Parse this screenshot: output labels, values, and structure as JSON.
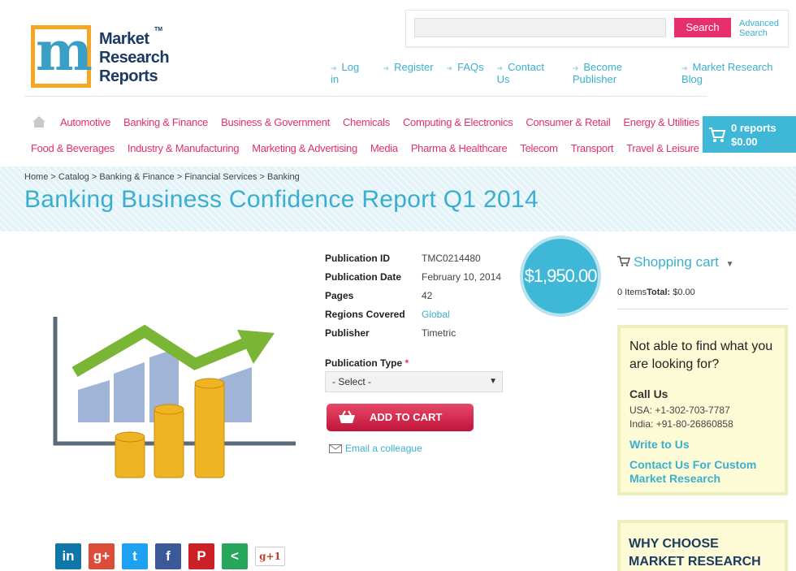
{
  "logo": {
    "line1": "Market",
    "line2": "Research",
    "line3": "Reports",
    "tm": "TM",
    "letter": "m"
  },
  "search": {
    "button": "Search",
    "advanced_line1": "Advanced",
    "advanced_line2": "Search",
    "placeholder": ""
  },
  "top_links": [
    "Log in",
    "Register",
    "FAQs",
    "Contact Us",
    "Become Publisher",
    "Market Research Blog"
  ],
  "categories_row1": [
    "Automotive",
    "Banking & Finance",
    "Business & Government",
    "Chemicals",
    "Computing & Electronics",
    "Consumer & Retail",
    "Energy & Utilities"
  ],
  "categories_row2": [
    "Food & Beverages",
    "Industry & Manufacturing",
    "Marketing & Advertising",
    "Media",
    "Pharma & Healthcare",
    "Telecom",
    "Transport",
    "Travel & Leisure"
  ],
  "cart": {
    "count": "0 reports",
    "total": "$0.00"
  },
  "breadcrumb": "Home > Catalog > Banking & Finance > Financial Services > Banking",
  "title": "Banking Business Confidence Report Q1 2014",
  "details": {
    "pub_id_label": "Publication ID",
    "pub_id": "TMC0214480",
    "pub_date_label": "Publication Date",
    "pub_date": "February 10, 2014",
    "pages_label": "Pages",
    "pages": "42",
    "regions_label": "Regions Covered",
    "regions": "Global",
    "publisher_label": "Publisher",
    "publisher": "Timetric"
  },
  "price": "$1,950.00",
  "publication_type": {
    "label": "Publication Type",
    "required": "*",
    "selected": "- Select -"
  },
  "add_to_cart": "ADD TO CART",
  "email_colleague": "Email a colleague",
  "shopping_cart": {
    "title": "Shopping cart",
    "items": "0 Items",
    "total_label": "Total:",
    "total": "$0.00"
  },
  "help_box": {
    "heading": "Not able to find what you are looking for?",
    "call_us": "Call Us",
    "usa": "USA: +1-302-703-7787",
    "india": "India: +91-80-26860858",
    "write_to_us": "Write to Us",
    "custom_line1": "Contact Us For Custom",
    "custom_line2": "Market Research"
  },
  "why_box": {
    "line1": "WHY CHOOSE",
    "line2": "MARKET RESEARCH"
  },
  "social": [
    {
      "name": "linkedin-icon",
      "glyph": "in",
      "color": "#0e76a8"
    },
    {
      "name": "googleplus-icon",
      "glyph": "g+",
      "color": "#dd4b39"
    },
    {
      "name": "twitter-icon",
      "glyph": "t",
      "color": "#1da1f2"
    },
    {
      "name": "facebook-icon",
      "glyph": "f",
      "color": "#3b5998"
    },
    {
      "name": "pinterest-icon",
      "glyph": "P",
      "color": "#cb2027"
    },
    {
      "name": "share-icon",
      "glyph": "<",
      "color": "#26a65b"
    }
  ],
  "gplus_one": "g+1"
}
